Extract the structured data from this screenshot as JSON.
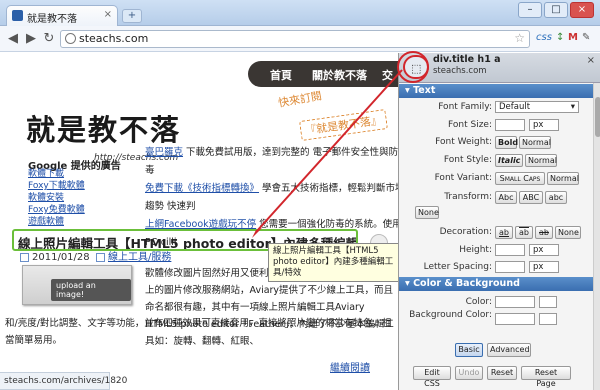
{
  "browser": {
    "tab_title": "就是教不落",
    "tab_close": "×",
    "new_tab": "+",
    "url": "steachs.com",
    "ext_css": "css",
    "win_min": "–",
    "win_max": "□",
    "win_close": "×"
  },
  "site": {
    "menu": [
      "首頁",
      "關於教不落",
      "交"
    ],
    "logo": "就是教不落",
    "logo_sub": "http://steachs.com",
    "stamp1": "快來訂閱",
    "stamp2": "『就是教不落』",
    "ad_title": "Google 提供的廣告",
    "ad_links": [
      "軟體下載",
      "Foxy下載軟體",
      "軟體安裝",
      "Foxy免費軟體",
      "遊戲軟體"
    ],
    "news": [
      {
        "link": "臺巴羅克",
        "text": "下載免費試用版，達到完整的 電子郵件安全性與防毒"
      },
      {
        "link": "免費下載《技術指標轉換》",
        "text": "學會五大技術指標，輕鬆判斷市場趨勢 快速判"
      },
      {
        "link": "上網Facebook遊戲玩不停",
        "text": "您需要一個強化防毒的系統。使用PC-cilli"
      }
    ],
    "post_title": "線上照片編輯工具【HTML5 photo editor】內建多種編輯工具/特效",
    "post_date": "2011/01/28",
    "post_category": "線上工具/服務",
    "upload_label": "upload an image!",
    "body1": "歡體修改圖片固然好用又便利，不過總是會偶而會使用到線上的圖片修改服務網站，Aviary提供了不少線上工具，而且命名都很有趣，其中有一項線上照片編輯工具Aviary HTML5 photo editor「Feather」，內建了不少基本編輯工具如：旋轉、翻轉、紅眼、",
    "body2": "和/亮度/對比調整、文字等功能，並有四種效果可直接套用，直接將照片變的相當有特色，相當簡單易用。",
    "more": "繼續閱讀",
    "tooltip": "線上照片編輯工具【HTML5 photo editor】內建多種編輯工具/特效",
    "status_url": "steachs.com/archives/1820"
  },
  "panel": {
    "path": "div.title h1 a",
    "path_sub": "steachs.com",
    "close": "×",
    "text_section": "Text",
    "font_family_label": "Font Family:",
    "font_family_value": "Default",
    "font_size_label": "Font Size:",
    "font_size_unit": "px",
    "font_weight_label": "Font Weight:",
    "font_weight_bold": "Bold",
    "font_weight_normal": "Normal",
    "font_style_label": "Font Style:",
    "font_style_italic": "Italic",
    "font_style_normal": "Normal",
    "font_variant_label": "Font Variant:",
    "font_variant_small": "Small Caps",
    "font_variant_normal": "Normal",
    "transform_label": "Transform:",
    "transform_abc1": "Abc",
    "transform_abc2": "ABC",
    "transform_abc3": "abc",
    "transform_none": "None",
    "decoration_label": "Decoration:",
    "deco_u": "ab",
    "deco_o": "ab",
    "deco_s": "ab",
    "deco_none": "None",
    "line_height_label": "Height:",
    "letter_spacing_label": "Letter Spacing:",
    "color_section": "Color & Background",
    "color_label": "Color:",
    "bg_color_label": "Background Color:",
    "basic": "Basic",
    "advanced": "Advanced",
    "edit_css": "Edit CSS",
    "undo": "Undo",
    "reset": "Reset",
    "reset_page": "Reset Page"
  },
  "colors": {
    "accent": "#3a6eb0",
    "highlight": "#d2262c",
    "title_border": "#6bbf3a"
  }
}
